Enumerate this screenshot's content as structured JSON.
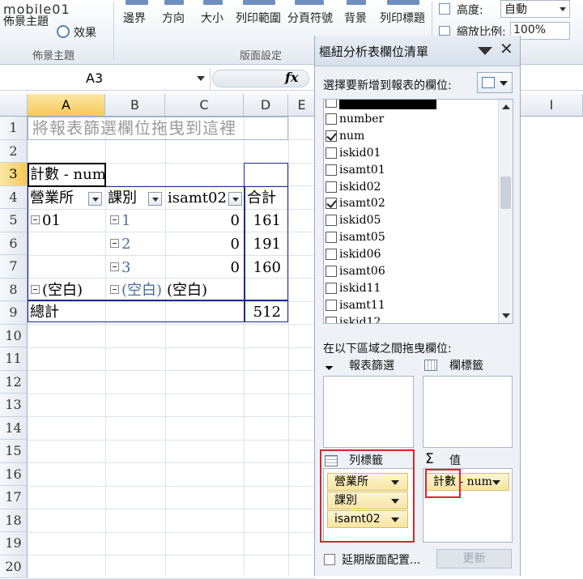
{
  "ribbon": {
    "logo": "mobile01",
    "theme_label": "佈景主題",
    "effect_label": "效果",
    "theme_group": "佈景主題",
    "buttons": [
      "邊界",
      "方向",
      "大小",
      "列印範圍",
      "分頁符號",
      "背景",
      "列印標題"
    ],
    "page_setup_group": "版面設定",
    "height_label": "高度:",
    "height_value": "自動",
    "scale_label": "縮放比例:",
    "scale_value": "100%"
  },
  "formula_bar": {
    "name_box": "A3",
    "fx": "fx"
  },
  "grid": {
    "columns": [
      "A",
      "B",
      "C",
      "D",
      "E",
      "I"
    ],
    "rows": [
      "1",
      "2",
      "3",
      "4",
      "5",
      "6",
      "7",
      "8",
      "9",
      "10",
      "11",
      "12",
      "13",
      "14",
      "15",
      "16",
      "17",
      "18",
      "19",
      "20"
    ],
    "drop_hint": "將報表篩選欄位拖曳到這裡",
    "value_label": "計數 - num",
    "headers": {
      "a": "營業所",
      "b": "課別",
      "c": "isamt02",
      "d": "合計"
    },
    "rows_data": [
      {
        "a": "01",
        "b": "1",
        "c": "0",
        "d": "161"
      },
      {
        "a": "",
        "b": "2",
        "c": "0",
        "d": "191"
      },
      {
        "a": "",
        "b": "3",
        "c": "0",
        "d": "160"
      },
      {
        "a": "(空白)",
        "b": "(空白)",
        "c": "(空白)",
        "d": ""
      }
    ],
    "total_label": "總計",
    "total_value": "512"
  },
  "pivot_pane": {
    "title": "樞紐分析表欄位清單",
    "choose_label": "選擇要新增到報表的欄位:",
    "fields": [
      {
        "name": "",
        "checked": false,
        "redacted": true
      },
      {
        "name": "number",
        "checked": false
      },
      {
        "name": "num",
        "checked": true
      },
      {
        "name": "iskid01",
        "checked": false
      },
      {
        "name": "isamt01",
        "checked": false
      },
      {
        "name": "iskid02",
        "checked": false
      },
      {
        "name": "isamt02",
        "checked": true
      },
      {
        "name": "iskid05",
        "checked": false
      },
      {
        "name": "isamt05",
        "checked": false
      },
      {
        "name": "iskid06",
        "checked": false
      },
      {
        "name": "isamt06",
        "checked": false
      },
      {
        "name": "iskid11",
        "checked": false
      },
      {
        "name": "isamt11",
        "checked": false
      },
      {
        "name": "iskid12",
        "checked": false
      }
    ],
    "drag_label": "在以下區域之間拖曳欄位:",
    "report_filter": "報表篩選",
    "column_labels": "欄標籤",
    "row_labels": "列標籤",
    "values": "值",
    "row_fields": [
      "營業所",
      "課別",
      "isamt02"
    ],
    "value_field": {
      "prefix": "計數",
      "rest": " - num"
    },
    "defer_label": "延期版面配置...",
    "update_label": "更新"
  }
}
